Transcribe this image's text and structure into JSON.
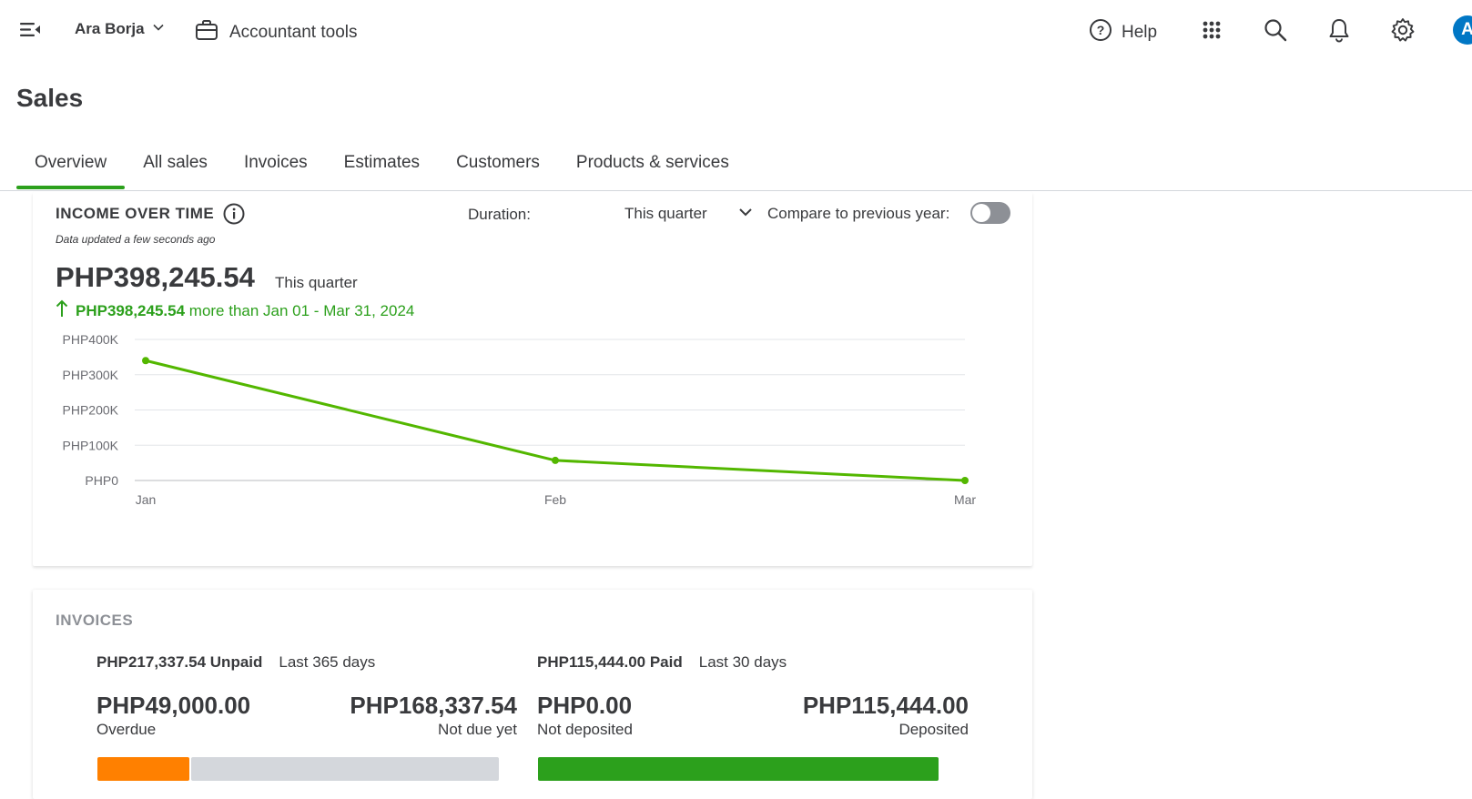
{
  "topbar": {
    "company_name": "Ara Borja",
    "accountant_tools": "Accountant tools",
    "help": "Help",
    "avatar_letter": "A"
  },
  "page": {
    "title": "Sales"
  },
  "tabs": [
    {
      "label": "Overview",
      "active": true
    },
    {
      "label": "All sales"
    },
    {
      "label": "Invoices"
    },
    {
      "label": "Estimates"
    },
    {
      "label": "Customers"
    },
    {
      "label": "Products & services"
    }
  ],
  "income": {
    "title": "INCOME OVER TIME",
    "updated": "Data updated a few seconds ago",
    "duration_label": "Duration:",
    "duration_value": "This quarter",
    "compare_label": "Compare to previous year:",
    "compare_on": false,
    "total": "PHP398,245.54",
    "period": "This quarter",
    "delta_amount": "PHP398,245.54",
    "delta_text": "more than Jan 01 - Mar 31, 2024"
  },
  "chart_data": {
    "type": "line",
    "x": [
      "Jan",
      "Feb",
      "Mar"
    ],
    "series": [
      {
        "values": [
          340000,
          57000,
          0
        ]
      }
    ],
    "ytick_labels": [
      "PHP0",
      "PHP100K",
      "PHP200K",
      "PHP300K",
      "PHP400K"
    ],
    "ylim": [
      0,
      400000
    ],
    "grid": true,
    "color": "#53b700"
  },
  "invoices": {
    "title": "INVOICES",
    "unpaid": {
      "amount": "PHP217,337.54",
      "label": "Unpaid",
      "range": "Last 365 days",
      "overdue_amount": "PHP49,000.00",
      "overdue_label": "Overdue",
      "notdue_amount": "PHP168,337.54",
      "notdue_label": "Not due yet"
    },
    "paid": {
      "amount": "PHP115,444.00",
      "label": "Paid",
      "range": "Last 30 days",
      "notdeposited_amount": "PHP0.00",
      "notdeposited_label": "Not deposited",
      "deposited_amount": "PHP115,444.00",
      "deposited_label": "Deposited"
    },
    "colors": {
      "overdue": "#ff8000",
      "notdue": "#d4d7dc",
      "deposited": "#2ca01c"
    }
  },
  "colors": {
    "accent": "#2ca01c",
    "avatar": "#0077c5"
  }
}
